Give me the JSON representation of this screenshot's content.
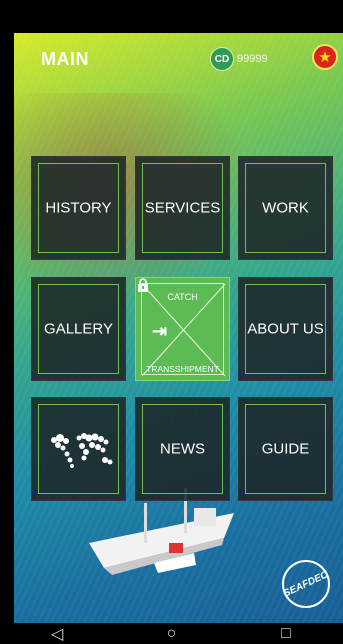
{
  "header": {
    "title": "MAIN",
    "coin_icon": "CD",
    "coin_value": "99999"
  },
  "tiles": {
    "history": "HISTORY",
    "services": "SERVICES",
    "work": "WORK",
    "gallery": "GALLERY",
    "about": "ABOUT US",
    "news": "NEWS",
    "guide": "GUIDE"
  },
  "center": {
    "top": "CATCH",
    "bottom": "TRANSSHIPMENT"
  },
  "colors": {
    "accent": "#6fbf52",
    "tile_bg": "#1e2628",
    "center_green": "#5dbb53",
    "flag_red": "#da251d"
  },
  "icons": {
    "flag": "vietnam-flag-icon",
    "login": "login-icon",
    "lock": "lock-icon",
    "map": "world-map-icon"
  },
  "navigation": {
    "back": "◁",
    "home": "○",
    "recents": "□"
  }
}
